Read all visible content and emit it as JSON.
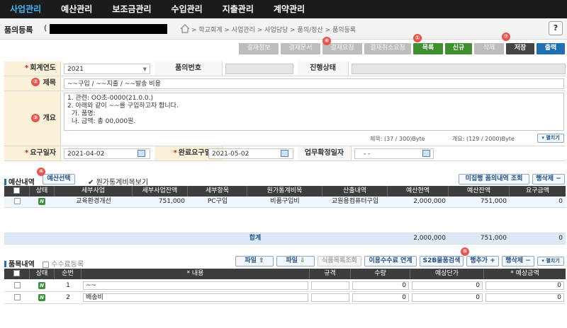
{
  "nav": {
    "items": [
      "사업관리",
      "예산관리",
      "보조금관리",
      "수입관리",
      "지출관리",
      "계약관리"
    ]
  },
  "titlebar": {
    "title": "품의등록",
    "paren": "(",
    "breadcrumb": "> 학교회계 > 사업관리 > 사업담당 > 품의/정산 > 품의등록",
    "help": "?"
  },
  "toolbar": {
    "approval_info": "결재정보",
    "approval_doc": "결재문서",
    "approval_request": "결재요청",
    "approval_cancel": "결재취소요청",
    "list": "목록",
    "new": "신규",
    "delete": "삭제",
    "save": "저장",
    "print": "출력"
  },
  "markers": {
    "m1": "①",
    "m2": "②",
    "m3": "③",
    "m4": "④",
    "m5": "⑤",
    "m6": "⑥",
    "m7": "⑦"
  },
  "form": {
    "fiscal_year_label": "회계연도",
    "fiscal_year_value": "2021",
    "pumui_no_label": "품의번호",
    "status_label": "진행상태",
    "subject_label": "제목",
    "subject_value": "~~구입 / ~~지출 / ~~발송 비용",
    "summary_label": "개요",
    "summary_lines": [
      "1. 관련: OO초-0000(21.0.0.)",
      "2. 아래와 같이 ~~를 구입하고자 합니다.",
      "가. 품명:",
      "나. 금액: 총 00,000원."
    ],
    "subject_count": "제목: (37 / 300)Byte",
    "summary_count": "개요: (129 / 2000)Byte",
    "expand": "펼치기",
    "request_date_label": "요구일자",
    "request_date_value": "2021-04-02",
    "complete_date_label": "완료요구일자",
    "complete_date_value": "2021-05-02",
    "confirm_date_label": "업무확정일자",
    "confirm_date_value": "- -"
  },
  "budget": {
    "title": "예산내역",
    "select_btn": "예산선택",
    "show_cost_label": "원가통계비목보기",
    "unexec_btn": "미집행 품의내역 조회",
    "delete_row_btn": "행삭제",
    "columns": [
      "상태",
      "세부사업",
      "세부사업잔액",
      "세부항목",
      "원가통계비목",
      "산출내역",
      "예산현액",
      "예산잔액",
      "요구금액"
    ],
    "rows": [
      {
        "status": "N",
        "project": "교육환경개선",
        "project_balance": "751,000",
        "item": "PC구입",
        "cost_item": "비품구입비",
        "calc": "교원용컴퓨터구입",
        "budget_amount": "2,000,000",
        "budget_balance": "751,000",
        "request": "0"
      }
    ],
    "total_label": "합계",
    "total_budget": "2,000,000",
    "total_balance": "751,000",
    "total_request": "0"
  },
  "items": {
    "title": "품목내역",
    "fee_label": "수수료등록",
    "file_up": "파일",
    "file_down": "파일",
    "food_btn": "식품목록조회",
    "fee_link_btn": "이용수수료 연계",
    "s2b_btn": "S2B물품검색",
    "add_row_btn": "행추가",
    "delete_row_btn": "행삭제",
    "expand_btn": "펼치기",
    "columns": [
      "상태",
      "순번",
      "내용",
      "규격",
      "수량",
      "예상단가",
      "예상금액"
    ],
    "rows": [
      {
        "status": "N",
        "seq": "1",
        "content": "~~",
        "qty": "0",
        "price": "0",
        "amount": "0"
      },
      {
        "status": "N",
        "seq": "2",
        "content": "배송비",
        "qty": "0",
        "price": "0",
        "amount": "0"
      }
    ]
  }
}
